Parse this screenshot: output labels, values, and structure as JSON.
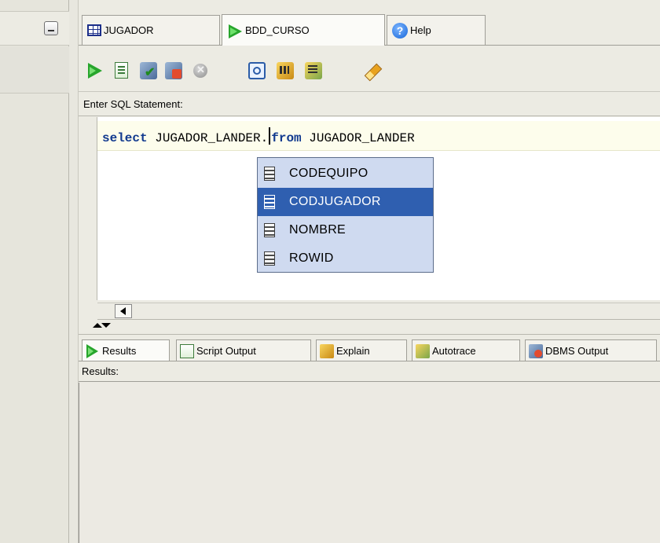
{
  "tabs": [
    {
      "label": "JUGADOR",
      "icon": "table-grid-icon"
    },
    {
      "label": "BDD_CURSO",
      "icon": "sql-worksheet-play-icon"
    },
    {
      "label": "Help",
      "icon": "help-icon"
    }
  ],
  "editor": {
    "label": "Enter SQL Statement:",
    "keyword_select": "select",
    "text_before_caret": " JUGADOR_LANDER.",
    "keyword_from": "from",
    "text_after": " JUGADOR_LANDER"
  },
  "autocomplete": {
    "items": [
      "CODEQUIPO",
      "CODJUGADOR",
      "NOMBRE",
      "ROWID"
    ],
    "selected": "CODJUGADOR"
  },
  "results": {
    "tabs": [
      "Results",
      "Script Output",
      "Explain",
      "Autotrace",
      "DBMS Output"
    ],
    "label": "Results:"
  },
  "colors": {
    "keyword": "#123a8f",
    "autocomplete_bg": "#cfdaf0",
    "autocomplete_selected": "#2f5fb0",
    "run_green": "#27a52c"
  }
}
